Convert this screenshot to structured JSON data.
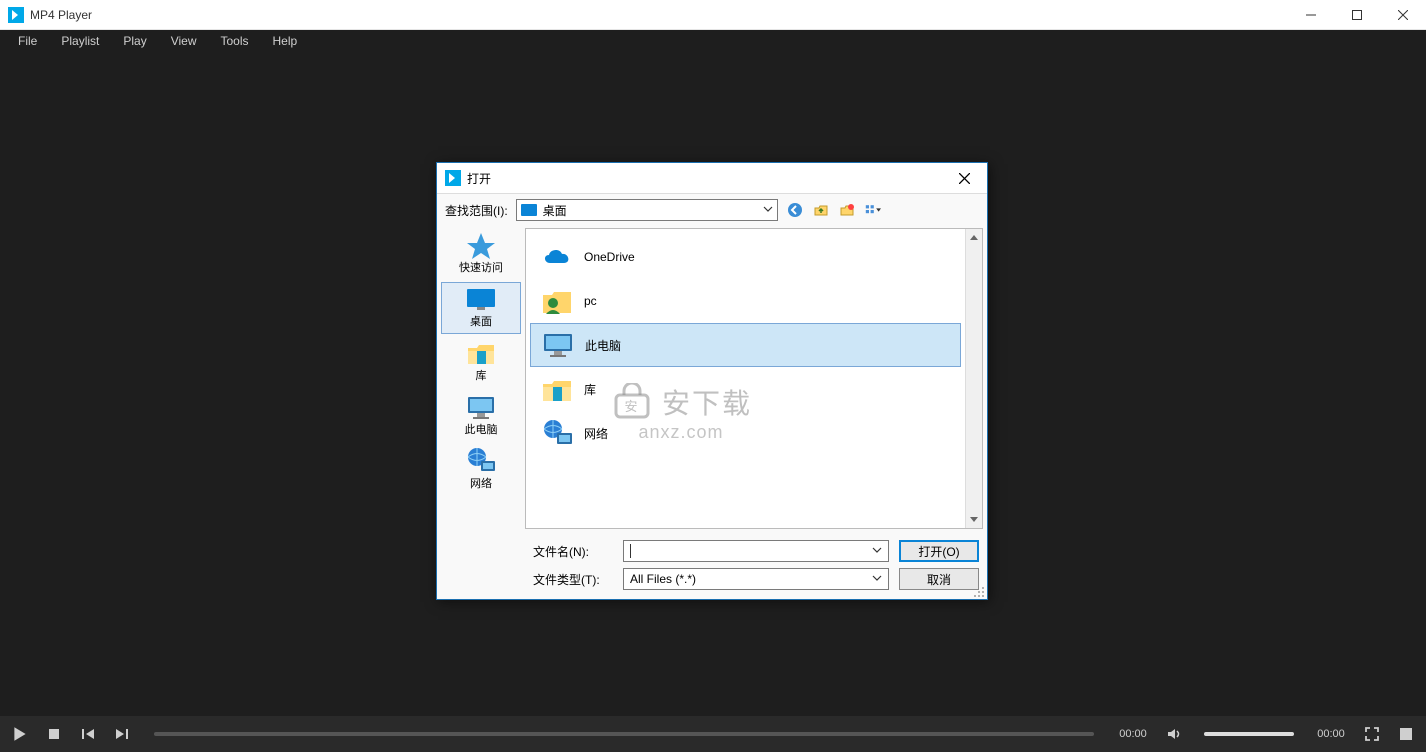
{
  "app": {
    "title": "MP4 Player"
  },
  "menu": [
    "File",
    "Playlist",
    "Play",
    "View",
    "Tools",
    "Help"
  ],
  "controls": {
    "time_current": "00:00",
    "time_total": "00:00"
  },
  "dialog": {
    "title": "打开",
    "lookin_label": "查找范围(I):",
    "lookin_value": "桌面",
    "places": [
      {
        "label": "快速访问"
      },
      {
        "label": "桌面"
      },
      {
        "label": "库"
      },
      {
        "label": "此电脑"
      },
      {
        "label": "网络"
      }
    ],
    "items": [
      {
        "label": "OneDrive"
      },
      {
        "label": "pc"
      },
      {
        "label": "此电脑"
      },
      {
        "label": "库"
      },
      {
        "label": "网络"
      }
    ],
    "filename_label": "文件名(N):",
    "filename_value": "",
    "filetype_label": "文件类型(T):",
    "filetype_value": "All Files (*.*)",
    "open_button": "打开(O)",
    "cancel_button": "取消"
  },
  "watermark": {
    "line1": "安下载",
    "line2": "anxz.com"
  }
}
